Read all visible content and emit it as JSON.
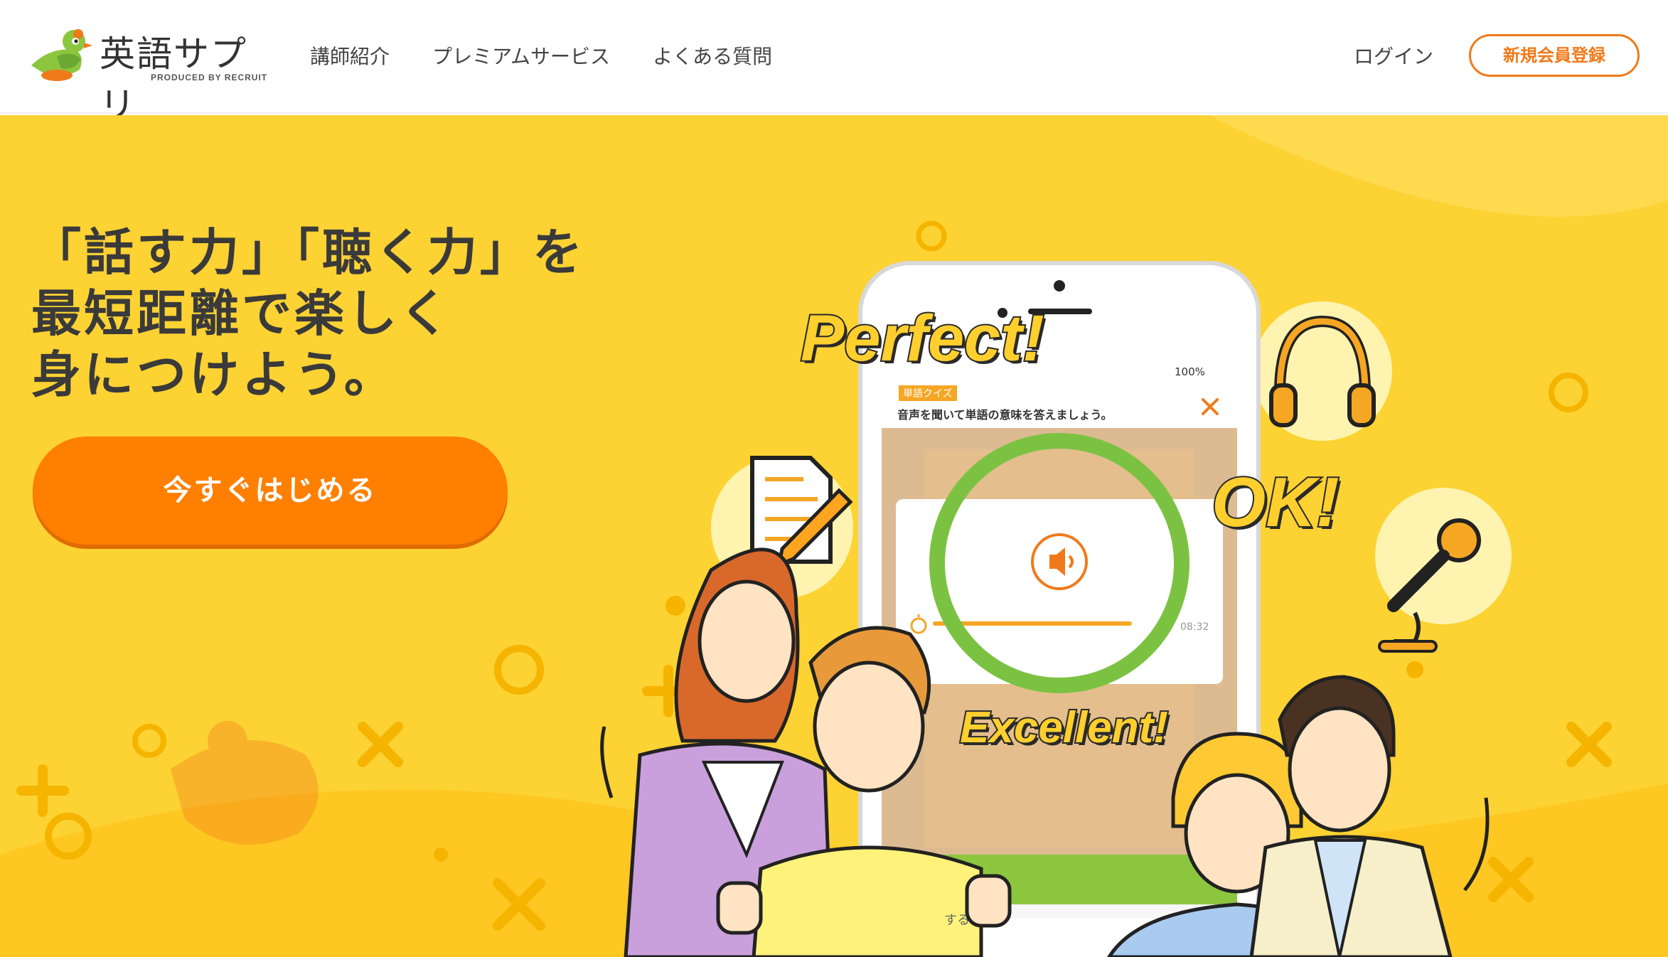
{
  "header": {
    "logo_text": "英語サプリ",
    "logo_subtext": "PRODUCED BY RECRUIT",
    "nav": [
      "講師紹介",
      "プレミアムサービス",
      "よくある質問"
    ],
    "login_label": "ログイン",
    "register_label": "新規会員登録"
  },
  "hero": {
    "headline": [
      "「話す力」「聴く力」を",
      "最短距離で楽しく",
      "身につけよう。"
    ],
    "cta_label": "今すぐはじめる",
    "phone": {
      "battery": "100%",
      "quiz_badge": "単語クイズ",
      "quiz_prompt": "音声を聞いて単語の意味を答えましょう。",
      "timer": "08:32",
      "bottom_text": "する"
    },
    "shouts": {
      "perfect": "Perfect!",
      "ok": "OK!",
      "excellent": "Excellent!"
    }
  },
  "colors": {
    "brand_orange": "#ff7f00",
    "hero_yellow": "#fdd233",
    "ring_green": "#7cc242",
    "text_dark": "#3a3a3a"
  },
  "icons": [
    "bird-logo-icon",
    "document-pencil-icon",
    "headphones-icon",
    "microphone-icon",
    "speaker-icon",
    "close-icon",
    "stopwatch-icon"
  ]
}
